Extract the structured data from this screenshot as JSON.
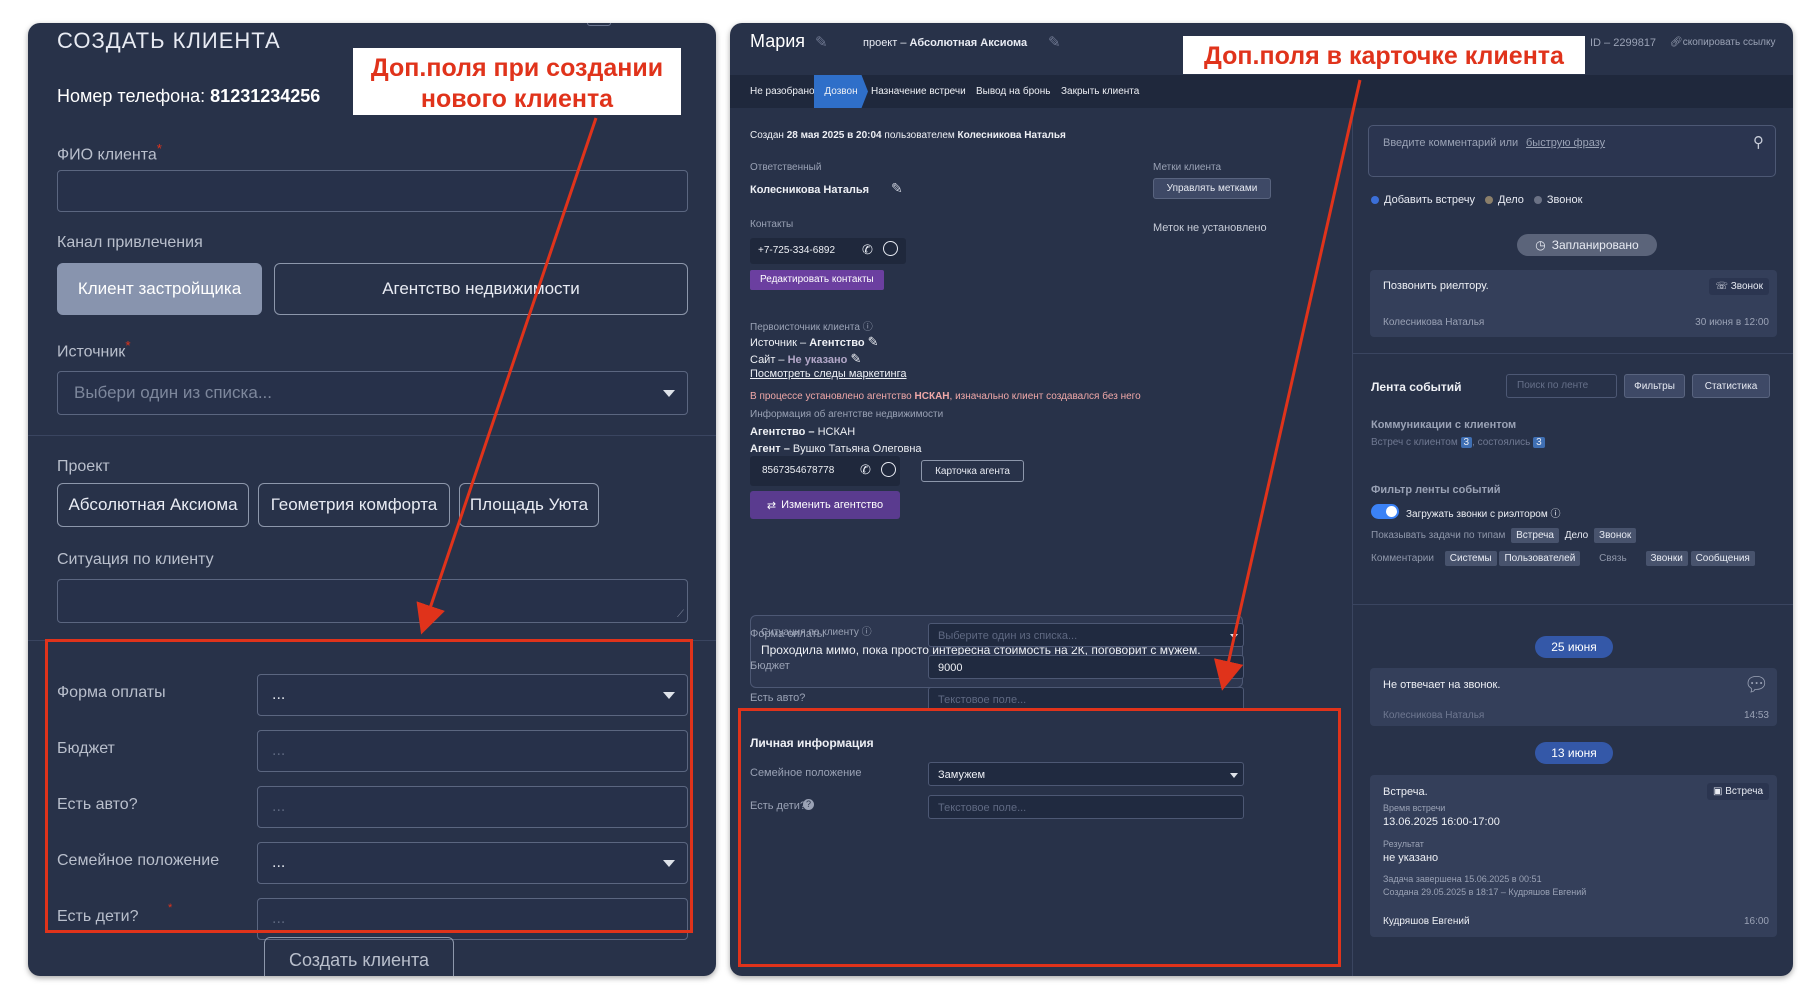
{
  "left": {
    "title": "СОЗДАТЬ КЛИЕНТА",
    "phone_label": "Номер телефона:",
    "phone_value": "81231234256",
    "fio_label": "ФИО клиента",
    "required_mark": "*",
    "channel_label": "Канал привлечения",
    "channel_options": [
      "Клиент застройщика",
      "Агентство недвижимости"
    ],
    "source_label": "Источник",
    "source_placeholder": "Выбери один из списка...",
    "project_label": "Проект",
    "projects": [
      "Абсолютная Аксиома",
      "Геометрия комфорта",
      "Площадь Уюта"
    ],
    "situation_label": "Ситуация по клиенту",
    "extra_fields": [
      {
        "label": "Форма оплаты",
        "value": "...",
        "type": "select"
      },
      {
        "label": "Бюджет",
        "value": "...",
        "type": "text"
      },
      {
        "label": "Есть авто?",
        "value": "...",
        "type": "text"
      },
      {
        "label": "Семейное положение",
        "value": "...",
        "type": "select"
      },
      {
        "label": "Есть дети?",
        "value": "...",
        "type": "text"
      }
    ],
    "submit_label": "Создать клиента"
  },
  "callout_left": [
    "Доп.поля при создании",
    "нового клиента"
  ],
  "callout_right": "Доп.поля в карточке клиента",
  "right": {
    "client_name": "Мария",
    "project_prefix": "проект –",
    "project_name": "Абсолютная Аксиома",
    "id_text": "ID – 2299817",
    "copy_link": "скопировать ссылку",
    "stages": [
      "Не разобрано",
      "Дозвон",
      "Назначение встречи",
      "Вывод на бронь",
      "Закрыть клиента"
    ],
    "active_stage": 1,
    "created_prefix": "Создан",
    "created_date": "28 мая 2025 в 20:04",
    "created_by": "пользователем",
    "created_user": "Колесникова Наталья",
    "responsible_label": "Ответственный",
    "responsible_name": "Колесникова Наталья",
    "tags_label": "Метки клиента",
    "tags_button": "Управлять метками",
    "tags_empty": "Меток не установлено",
    "contacts_label": "Контакты",
    "contact_phone": "+7-725-334-6892",
    "edit_contacts": "Редактировать контакты",
    "source_section": "Первоисточник клиента",
    "source_line": "Источник –",
    "source_value": "Агентство",
    "site_line": "Сайт –",
    "site_value": "Не указано",
    "marketing_link": "Посмотреть следы маркетинга",
    "agency_note_prefix": "В процессе установлено агентство",
    "agency_note_name": "НСКАН",
    "agency_note_suffix": ", изначально клиент создавался без него",
    "agency_info_label": "Информация об агентстве недвижимости",
    "agency_label": "Агентство –",
    "agency_value": "НСКАН",
    "agent_label": "Агент –",
    "agent_value": "Вушко Татьяна Олеговна",
    "agent_phone": "8567354678778",
    "agent_card": "Карточка агента",
    "change_agency": "Изменить агентство",
    "situation_label": "Ситуация по клиенту",
    "situation_text": "Проходила мимо, пока просто интересна стоимость на 2К, поговорит с мужем.",
    "extra_fields": [
      {
        "label": "Форма оплаты",
        "value": "Выберите один из списка...",
        "type": "select",
        "placeholder": true
      },
      {
        "label": "Бюджет",
        "value": "9000",
        "type": "text",
        "placeholder": false
      },
      {
        "label": "Есть авто?",
        "value": "Текстовое поле...",
        "type": "text",
        "placeholder": true
      }
    ],
    "personal_header": "Личная информация",
    "personal_fields": [
      {
        "label": "Семейное положение",
        "value": "Замужем",
        "type": "select",
        "placeholder": false
      },
      {
        "label": "Есть дети?",
        "value": "Текстовое поле...",
        "type": "text",
        "placeholder": true
      }
    ],
    "comment_placeholder": "Введите комментарий или",
    "comment_link": "быструю фразу",
    "task_types": [
      {
        "label": "Добавить встречу",
        "color": "#3b6fd8"
      },
      {
        "label": "Дело",
        "color": "#8b7f6a"
      },
      {
        "label": "Звонок",
        "color": "#6b7285"
      }
    ],
    "planned_label": "Запланировано",
    "planned_task": {
      "title": "Позвонить риелтору.",
      "type": "Звонок",
      "user": "Колесникова Наталья",
      "date": "30 июня в 12:00"
    },
    "feed_title": "Лента событий",
    "feed_search_placeholder": "Поиск по ленте",
    "filters_btn": "Фильтры",
    "stats_btn": "Статистика",
    "comm_title": "Коммуникации с клиентом",
    "meetings_label": "Встреч с клиентом",
    "meetings_count": "3",
    "held_label": "состоялись",
    "held_count": "3",
    "filter_title": "Фильтр ленты событий",
    "toggle_label": "Загружать звонки с риэлтором",
    "show_tasks_label": "Показывать задачи по типам",
    "task_filters": [
      "Встреча",
      "Дело",
      "Звонок"
    ],
    "comments_label": "Комментарии",
    "comment_filters": [
      "Системы",
      "Пользователей"
    ],
    "link_label": "Связь",
    "link_filters": [
      "Звонки",
      "Сообщения"
    ],
    "date1": "25 июня",
    "event1": {
      "title": "Не отвечает на звонок.",
      "user": "Колесникова Наталья",
      "time": "14:53"
    },
    "date2": "13 июня",
    "event2": {
      "title": "Встреча.",
      "type": "Встреча",
      "time_label": "Время встречи",
      "time_value": "13.06.2025 16:00-17:00",
      "result_label": "Результат",
      "result_value": "не указано",
      "done": "Задача завершена 15.06.2025 в 00:51",
      "created": "Создана 29.05.2025 в 18:17 – Кудряшов Евгений",
      "user": "Кудряшов Евгений",
      "clock": "16:00"
    }
  }
}
